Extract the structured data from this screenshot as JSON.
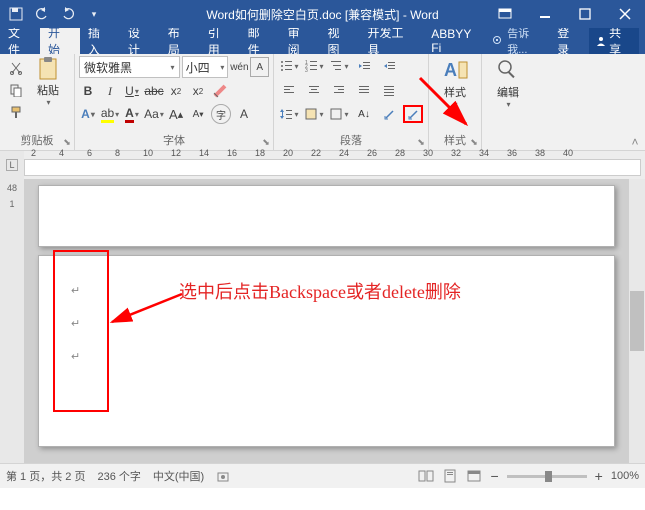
{
  "titlebar": {
    "title": "Word如何删除空白页.doc [兼容模式] - Word"
  },
  "tabs": {
    "file": "文件",
    "home": "开始",
    "insert": "插入",
    "design": "设计",
    "layout": "布局",
    "references": "引用",
    "mailings": "邮件",
    "review": "审阅",
    "view": "视图",
    "developer": "开发工具",
    "abbyy": "ABBYY Fi"
  },
  "tellme": "告诉我...",
  "login": "登录",
  "share": "共享",
  "clipboard": {
    "paste": "粘贴",
    "label": "剪贴板"
  },
  "font": {
    "name": "微软雅黑",
    "size": "小四",
    "label": "字体"
  },
  "paragraph": {
    "label": "段落"
  },
  "styles": {
    "label": "样式",
    "btn": "样式"
  },
  "editing": {
    "label": "编辑"
  },
  "ruler": {
    "marks": [
      "2",
      "4",
      "6",
      "8",
      "10",
      "12",
      "14",
      "16",
      "18",
      "20",
      "22",
      "24",
      "26",
      "28",
      "30",
      "32",
      "34",
      "36",
      "38",
      "40"
    ],
    "vmarks": [
      "48",
      "1"
    ]
  },
  "annotation": "选中后点击Backspace或者delete删除",
  "status": {
    "page": "第 1 页，共 2 页",
    "words": "236 个字",
    "lang": "中文(中国)",
    "zoom": "100%"
  }
}
